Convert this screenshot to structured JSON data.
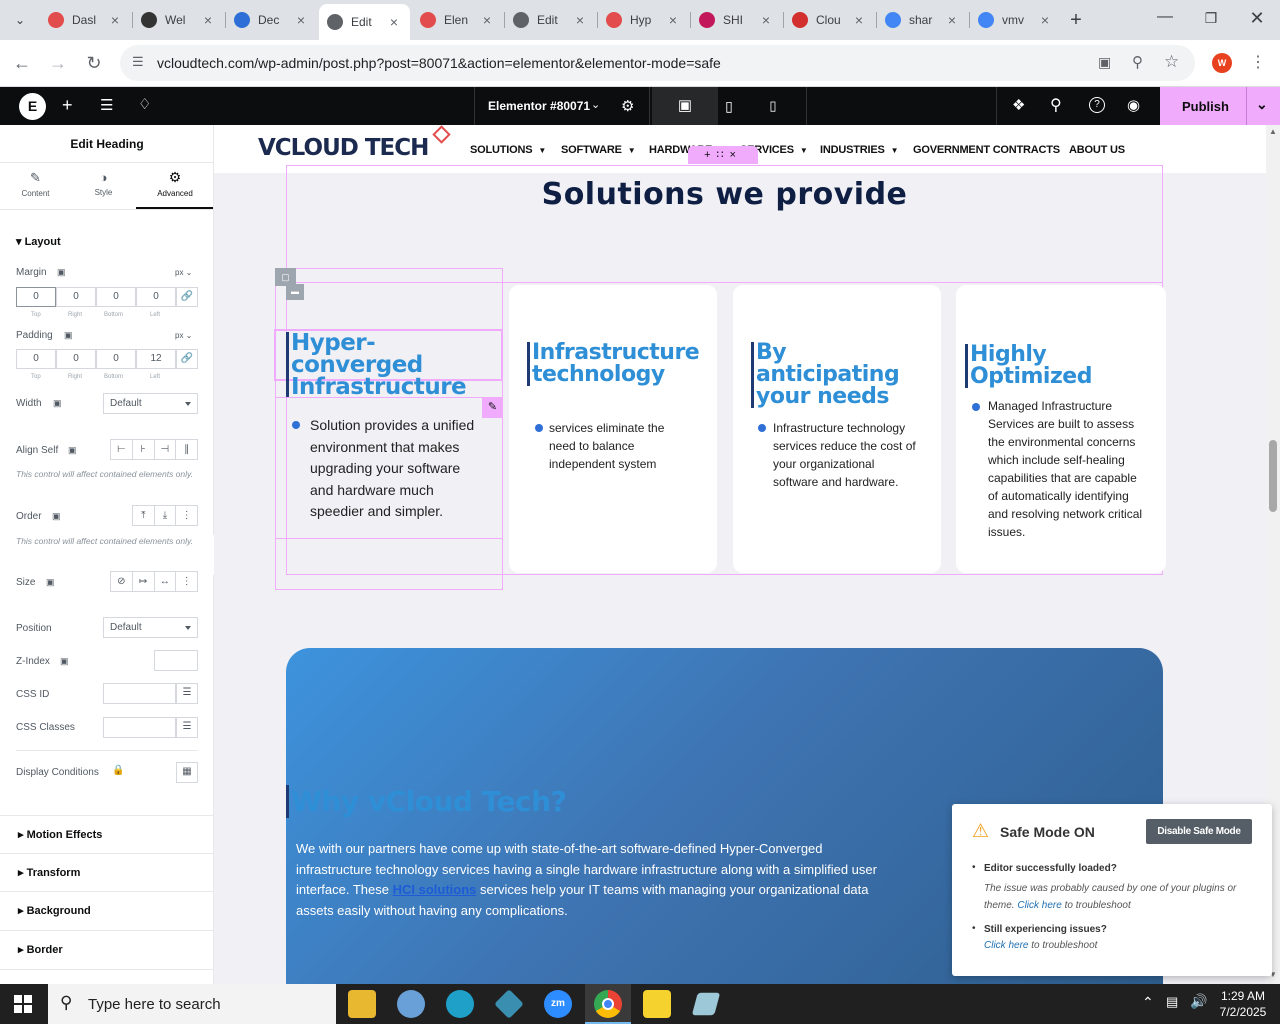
{
  "browser": {
    "tabs": [
      {
        "label": "Dasl",
        "color": "#e34c4c"
      },
      {
        "label": "Wel",
        "color": "#333333"
      },
      {
        "label": "Dec",
        "color": "#2d6fd6"
      },
      {
        "label": "Edit",
        "color": "#5f6368"
      },
      {
        "label": "Elen",
        "color": "#e34c4c"
      },
      {
        "label": "Edit",
        "color": "#5f6368"
      },
      {
        "label": "Hyp",
        "color": "#e34c4c"
      },
      {
        "label": "SHI",
        "color": "#c2185b"
      },
      {
        "label": "Clou",
        "color": "#d32f2f"
      },
      {
        "label": "shar",
        "color": "#4285f4"
      },
      {
        "label": "vmv",
        "color": "#4285f4"
      }
    ],
    "active_tab": 3,
    "url": "vcloudtech.com/wp-admin/post.php?post=80071&action=elementor&elementor-mode=safe",
    "profile_initial": "W"
  },
  "elementor": {
    "document_title": "Elementor #80071",
    "publish_label": "Publish"
  },
  "panel": {
    "title": "Edit Heading",
    "tabs": [
      "Content",
      "Style",
      "Advanced"
    ],
    "layout_label": "Layout",
    "margin_label": "Margin",
    "padding_label": "Padding",
    "unit": "px",
    "margin": [
      "0",
      "0",
      "0",
      "0"
    ],
    "padding": [
      "0",
      "0",
      "0",
      "12"
    ],
    "sides": [
      "Top",
      "Right",
      "Bottom",
      "Left"
    ],
    "width_label": "Width",
    "width_value": "Default",
    "align_self_label": "Align Self",
    "note": "This control will affect contained elements only.",
    "order_label": "Order",
    "size_label": "Size",
    "position_label": "Position",
    "position_value": "Default",
    "zindex_label": "Z-Index",
    "cssid_label": "CSS ID",
    "cssclasses_label": "CSS Classes",
    "display_conditions_label": "Display Conditions",
    "sections": [
      "Motion Effects",
      "Transform",
      "Background",
      "Border"
    ]
  },
  "site": {
    "logo_text": "VCLOUD TECH",
    "nav": [
      "SOLUTIONS",
      "SOFTWARE",
      "HARDWARE",
      "SERVICES",
      "INDUSTRIES",
      "GOVERNMENT CONTRACTS",
      "ABOUT US"
    ],
    "section_title": "Solutions we provide",
    "cards": [
      {
        "heading": "Hyper-converged Infrastructure",
        "text": "Solution provides a unified environment that makes upgrading your software and hardware much speedier and simpler."
      },
      {
        "heading": "Infrastructure technology",
        "text": "services eliminate the need to balance independent system"
      },
      {
        "heading": "By anticipating your needs",
        "text": "Infrastructure technology services reduce the cost of your organizational software and hardware."
      },
      {
        "heading": "Highly Optimized",
        "text": "Managed Infrastructure Services are built to assess the environmental concerns which include self-healing capabilities that are capable of automatically identifying and resolving network critical issues."
      }
    ],
    "why_title": "Why vCloud Tech?",
    "why_text_1": "We with our partners have come up with state-of-the-art software-defined Hyper-Converged infrastructure technology services having a single hardware infrastructure along with a simplified user interface. These ",
    "why_link": "HCI solutions",
    "why_text_2": " services help your IT teams with managing your organizational data assets easily without having any complications."
  },
  "safe_mode": {
    "title": "Safe Mode ON",
    "button": "Disable Safe Mode",
    "item1_title": "Editor successfully loaded?",
    "item1_text": "The issue was probably caused by one of your plugins or theme.",
    "item1_link": "Click here",
    "item1_tail": " to troubleshoot",
    "item2_title": "Still experiencing issues?",
    "item2_link": "Click here",
    "item2_tail": " to troubleshoot"
  },
  "taskbar": {
    "search_placeholder": "Type here to search",
    "time": "1:29 AM",
    "date": "7/2/2025"
  }
}
